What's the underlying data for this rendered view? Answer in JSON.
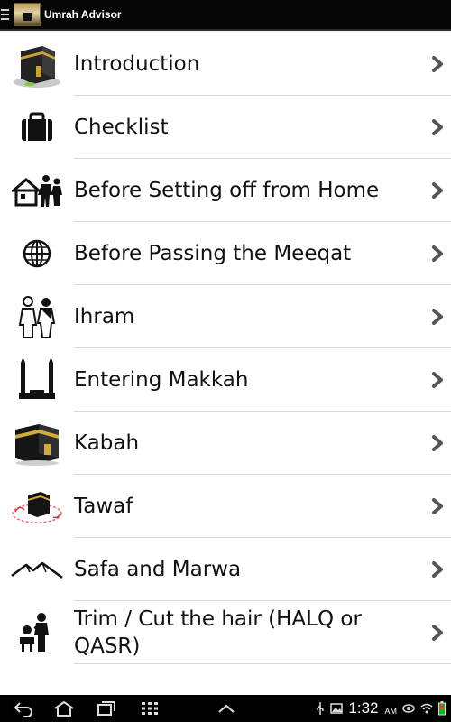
{
  "app": {
    "title": "Umrah Advisor"
  },
  "menu": {
    "items": [
      {
        "label": "Introduction",
        "icon": "kaaba-icon"
      },
      {
        "label": "Checklist",
        "icon": "briefcase-icon"
      },
      {
        "label": "Before Setting off from Home",
        "icon": "family-home-icon"
      },
      {
        "label": "Before Passing the Meeqat",
        "icon": "globe-icon"
      },
      {
        "label": "Ihram",
        "icon": "pilgrims-icon"
      },
      {
        "label": "Entering Makkah",
        "icon": "mosque-icon"
      },
      {
        "label": "Kabah",
        "icon": "kaaba-icon"
      },
      {
        "label": "Tawaf",
        "icon": "tawaf-icon"
      },
      {
        "label": "Safa and Marwa",
        "icon": "mountains-icon"
      },
      {
        "label": "Trim / Cut the hair (HALQ or QASR)",
        "icon": "barber-icon"
      }
    ]
  },
  "statusbar": {
    "time": "1:32",
    "ampm": "AM"
  },
  "colors": {
    "topbar": "#050505",
    "navbar": "#000000",
    "divider": "#d6d6d6",
    "text": "#111111"
  }
}
